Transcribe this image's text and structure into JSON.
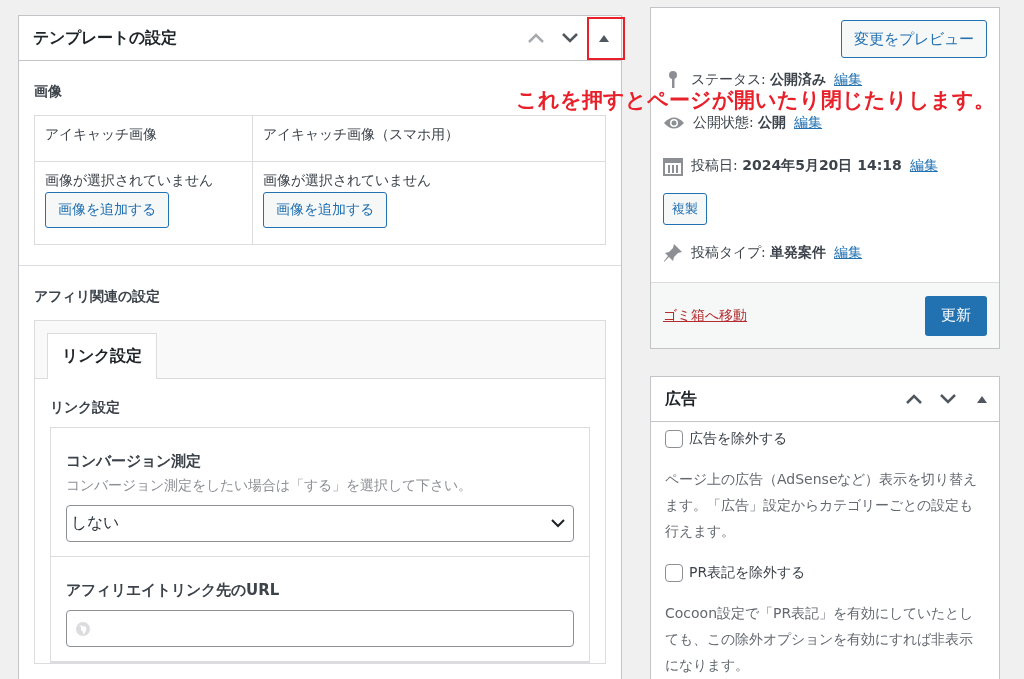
{
  "template_panel": {
    "title": "テンプレートの設定",
    "move_up_disabled": true,
    "toggle_highlighted": true,
    "image_section": {
      "heading": "画像",
      "columns": [
        {
          "header": "アイキャッチ画像",
          "status": "画像が選択されていません",
          "button": "画像を追加する"
        },
        {
          "header": "アイキャッチ画像（スマホ用）",
          "status": "画像が選択されていません",
          "button": "画像を追加する"
        }
      ]
    },
    "affiliate_section": {
      "heading": "アフィリ関連の設定",
      "tabs": [
        {
          "label": "リンク設定",
          "selected": true
        }
      ],
      "subheading": "リンク設定",
      "fields": [
        {
          "kind": "select",
          "label": "コンバージョン測定",
          "description": "コンバージョン測定をしたい場合は「する」を選択して下さい。",
          "value": "しない"
        },
        {
          "kind": "url",
          "label": "アフィリエイトリンク先のURL"
        }
      ]
    }
  },
  "annotation": "これを押すとページが開いたり閉じたりします。",
  "publish_panel": {
    "preview_button": "変更をプレビュー",
    "meta": [
      {
        "kind": "status",
        "label": "ステータス:",
        "value": "公開済み",
        "link": "編集"
      },
      {
        "kind": "visibility",
        "label": "公開状態:",
        "value": "公開",
        "link": "編集"
      },
      {
        "kind": "date",
        "label": "投稿日:",
        "value": "2024年5月20日 14:18",
        "link": "編集"
      },
      {
        "kind": "duplicate",
        "label": "複製"
      },
      {
        "kind": "type",
        "label": "投稿タイプ:",
        "value": "単発案件",
        "link": "編集"
      }
    ],
    "trash_link": "ゴミ箱へ移動",
    "update_button": "更新"
  },
  "ads_panel": {
    "title": "広告",
    "move_up_disabled": false,
    "options": [
      {
        "label": "広告を除外する",
        "checked": false,
        "description": "ページ上の広告（AdSenseなど）表示を切り替えます。「広告」設定からカテゴリーごとの設定も行えます。"
      },
      {
        "label": "PR表記を除外する",
        "checked": false,
        "description": "Cocoon設定で「PR表記」を有効にしていたとしても、この除外オプションを有効にすれば非表示になります。"
      }
    ]
  }
}
